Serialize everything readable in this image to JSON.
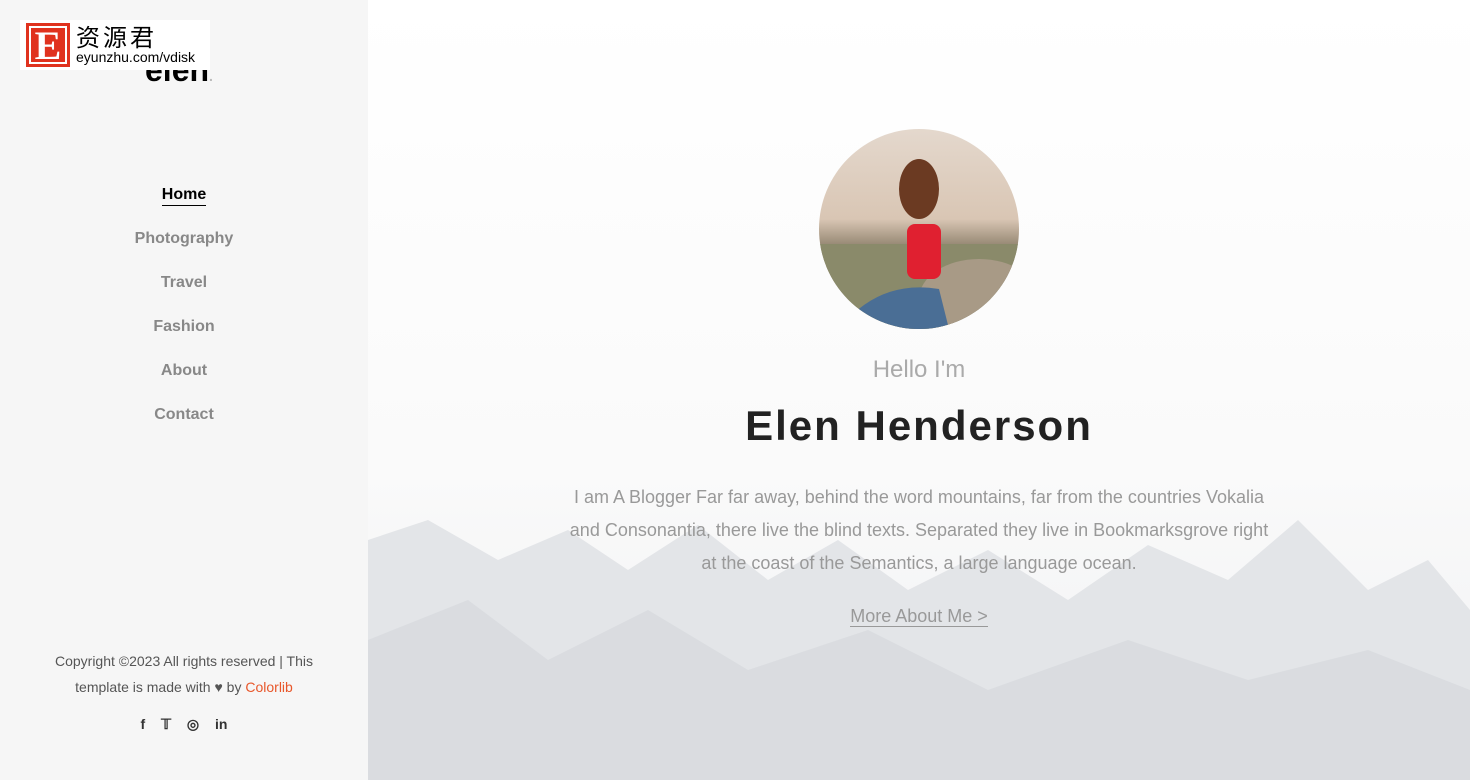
{
  "watermark": {
    "letter": "E",
    "chinese": "资源君",
    "url": "eyunzhu.com/vdisk"
  },
  "sidebar": {
    "logo": "elen",
    "logo_dot": ".",
    "nav": [
      {
        "label": "Home",
        "active": true
      },
      {
        "label": "Photography"
      },
      {
        "label": "Travel"
      },
      {
        "label": "Fashion"
      },
      {
        "label": "About"
      },
      {
        "label": "Contact"
      }
    ],
    "footer": {
      "line1": "Copyright ©2023 All rights reserved | This template is made with",
      "heart": "♥",
      "by": "by",
      "link": "Colorlib"
    },
    "social": [
      {
        "icon": "facebook-icon",
        "glyph": "f"
      },
      {
        "icon": "twitter-icon",
        "glyph": "🐦"
      },
      {
        "icon": "instagram-icon",
        "glyph": "◎"
      },
      {
        "icon": "linkedin-icon",
        "glyph": "in"
      }
    ]
  },
  "main": {
    "greeting": "Hello I'm",
    "name": "Elen Henderson",
    "bio": "I am A Blogger Far far away, behind the word mountains, far from the countries Vokalia and Consonantia, there live the blind texts. Separated they live in Bookmarksgrove right at the coast of the Semantics, a large language ocean.",
    "cta": "More About Me >"
  },
  "colors": {
    "accent": "#e8572b",
    "sidebar_bg": "#f6f6f6"
  }
}
